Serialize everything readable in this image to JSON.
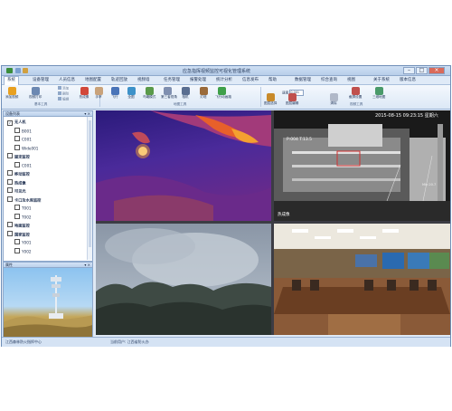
{
  "window": {
    "title": "应急指挥视频监控可视化管理系统"
  },
  "menu": {
    "tabs": [
      "系统",
      "设备管理",
      "人员信息",
      "地图配置",
      "轨迹回放",
      "视频墙",
      "任务管理",
      "报警处理",
      "统计分析",
      "信息发布",
      "帮助",
      "数据管理",
      "综合查询",
      "视图",
      "关于系统",
      "版本信息"
    ],
    "active_index": 0
  },
  "ribbon": {
    "buttons": [
      {
        "label": "添加视频",
        "icon": "video-add-icon",
        "color": "#e8a020"
      },
      {
        "label": "视频打印",
        "icon": "print-icon",
        "color": "#6c88b2"
      },
      {
        "label": "热成像",
        "icon": "thermal-icon",
        "color": "#d2483a"
      },
      {
        "label": "手掌",
        "icon": "hand-icon",
        "color": "#c9a27a"
      },
      {
        "label": "飞行",
        "icon": "fly-icon",
        "color": "#4a74b8"
      },
      {
        "label": "全图",
        "icon": "globe-icon",
        "color": "#3e92c9"
      },
      {
        "label": "鸟瞰模式",
        "icon": "birdview-icon",
        "color": "#5a9a4a"
      },
      {
        "label": "第三者视角",
        "icon": "third-view-icon",
        "color": "#7f8fb0"
      },
      {
        "label": "相机",
        "icon": "camera-icon",
        "color": "#5a6e90"
      },
      {
        "label": "灯塔",
        "icon": "lighthouse-icon",
        "color": "#9a6a3a"
      },
      {
        "label": "飞行动画路",
        "icon": "flight-path-icon",
        "color": "#3fa04a"
      },
      {
        "label": "图层选择",
        "icon": "layer-select-icon",
        "color": "#c88a2a"
      },
      {
        "label": "图层编辑",
        "icon": "layer-edit-icon",
        "color": "#c0504d"
      },
      {
        "label": "清除",
        "icon": "clear-icon",
        "color": "#b0b8c8"
      },
      {
        "label": "截屏设置",
        "icon": "capture-settings-icon",
        "color": "#c0504d"
      },
      {
        "label": "三维地图",
        "icon": "3d-map-icon",
        "color": "#4a9a6a"
      }
    ],
    "small_items": [
      "添加",
      "删除",
      "编辑"
    ],
    "groups": [
      "基本工具",
      "地图工具",
      "视频工具"
    ],
    "speed_label": "速度",
    "speed_value": "0.001"
  },
  "left_panel": {
    "tree_title": "设备列表",
    "tree": [
      {
        "label": "无人机",
        "level": 0,
        "checked": true,
        "bold": true
      },
      {
        "label": "B001",
        "level": 1,
        "checked": false
      },
      {
        "label": "C001",
        "level": 1,
        "checked": false
      },
      {
        "label": "Wide001",
        "level": 1,
        "checked": false
      },
      {
        "label": "固定监控",
        "level": 0,
        "checked": false,
        "bold": true
      },
      {
        "label": "C001",
        "level": 1,
        "checked": false
      },
      {
        "label": "移动监控",
        "level": 0,
        "checked": false,
        "bold": true
      },
      {
        "label": "热成像",
        "level": 0,
        "checked": false,
        "bold": true
      },
      {
        "label": "可见光",
        "level": 0,
        "checked": false,
        "bold": true
      },
      {
        "label": "卡口及水库监控",
        "level": 0,
        "checked": false,
        "bold": true
      },
      {
        "label": "T001",
        "level": 1,
        "checked": false
      },
      {
        "label": "T002",
        "level": 1,
        "checked": false
      },
      {
        "label": "地面监控",
        "level": 0,
        "checked": false,
        "bold": true
      },
      {
        "label": "国家监控",
        "level": 0,
        "checked": false,
        "bold": true
      },
      {
        "label": "Y001",
        "level": 1,
        "checked": false
      },
      {
        "label": "Y002",
        "level": 1,
        "checked": false
      }
    ],
    "photo_title": "属性"
  },
  "video": {
    "overlay_timestamp": "2015-08-15 09:23:15 星期六",
    "overlay_ptz": "P:004 T:13.5",
    "overlay_device": "热成像",
    "overlay_right": "Min:20.7"
  },
  "statusbar": {
    "left": "江西森林防火指挥中心",
    "middle": "当前用户: 江西省防火办"
  }
}
